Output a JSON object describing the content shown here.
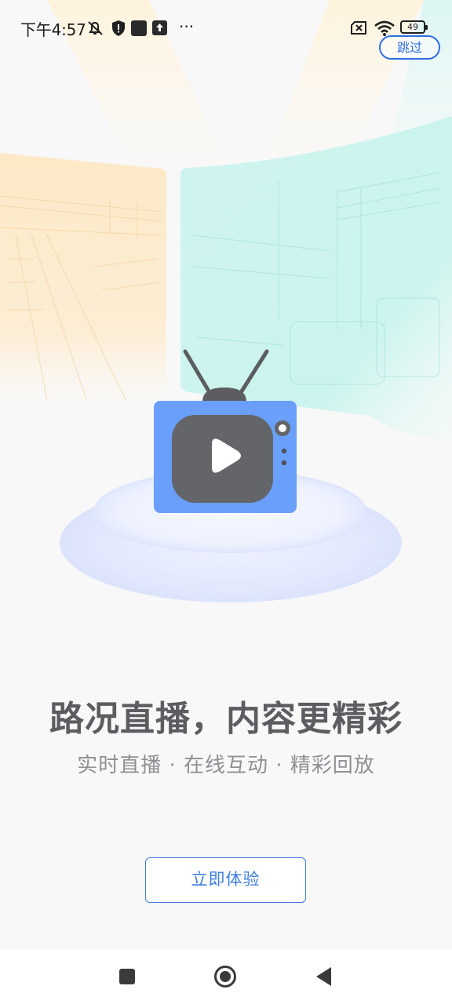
{
  "status_bar": {
    "time": "下午4:57",
    "more": "···",
    "battery": "49",
    "icons": [
      "mute-icon",
      "shield-icon",
      "app-icon",
      "upload-icon",
      "sim-blocked-icon",
      "wifi-icon",
      "battery-icon"
    ]
  },
  "skip_label": "跳过",
  "headline": "路况直播，内容更精彩",
  "subline": "实时直播 · 在线互动 · 精彩回放",
  "cta_label": "立即体验",
  "nav": {
    "buttons": [
      "recent-apps",
      "home",
      "back"
    ]
  },
  "colors": {
    "accent": "#3e7ddf",
    "tv_body": "#6a9ffb",
    "tv_screen": "#636568"
  }
}
